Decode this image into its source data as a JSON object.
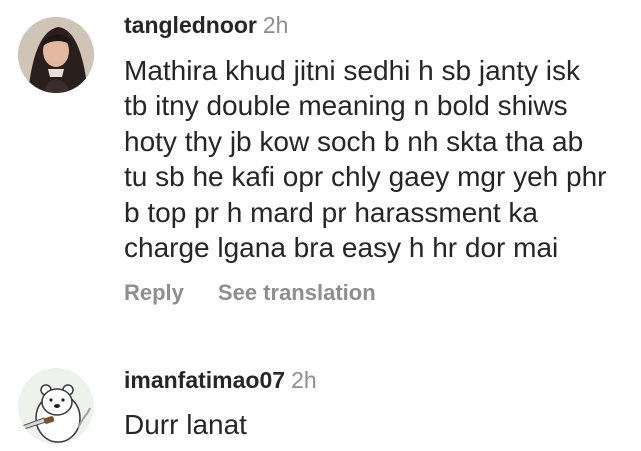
{
  "comments": [
    {
      "username": "tanglednoor",
      "time": "2h",
      "lines": [
        "Mathira khud jitni sedhi h sb janty isk",
        "tb itny double meaning n bold shiws",
        "hoty thy jb kow soch b nh skta tha ab",
        "tu sb he kafi opr chly gaey mgr yeh phr",
        "b top pr h mard pr harassment ka",
        "charge lgana bra easy h hr dor mai"
      ],
      "reply_label": "Reply",
      "translate_label": "See translation"
    },
    {
      "username": "imanfatimao07",
      "time": "2h",
      "lines": [
        "Durr lanat"
      ]
    }
  ]
}
